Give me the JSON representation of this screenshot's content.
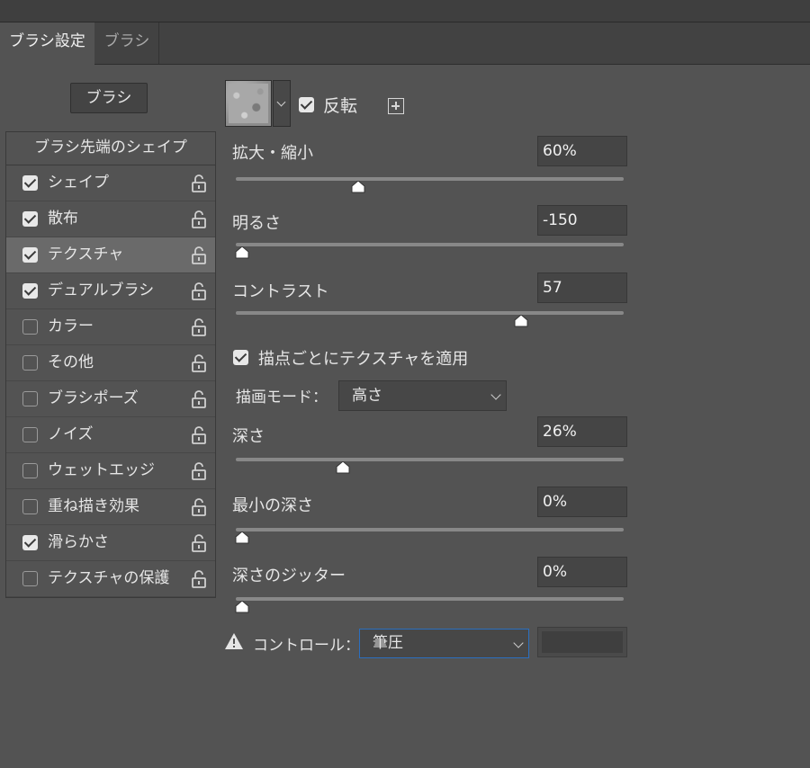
{
  "tabs": [
    {
      "label": "ブラシ設定",
      "active": true
    },
    {
      "label": "ブラシ",
      "active": false
    }
  ],
  "brush_button": "ブラシ",
  "left_panel": {
    "header": "ブラシ先端のシェイプ",
    "items": [
      {
        "label": "シェイプ",
        "checked": true,
        "selected": false
      },
      {
        "label": "散布",
        "checked": true,
        "selected": false
      },
      {
        "label": "テクスチャ",
        "checked": true,
        "selected": true
      },
      {
        "label": "デュアルブラシ",
        "checked": true,
        "selected": false
      },
      {
        "label": "カラー",
        "checked": false,
        "selected": false
      },
      {
        "label": "その他",
        "checked": false,
        "selected": false
      },
      {
        "label": "ブラシポーズ",
        "checked": false,
        "selected": false
      },
      {
        "label": "ノイズ",
        "checked": false,
        "selected": false
      },
      {
        "label": "ウェットエッジ",
        "checked": false,
        "selected": false
      },
      {
        "label": "重ね描き効果",
        "checked": false,
        "selected": false
      },
      {
        "label": "滑らかさ",
        "checked": true,
        "selected": false
      },
      {
        "label": "テクスチャの保護",
        "checked": false,
        "selected": false
      }
    ]
  },
  "texture": {
    "invert_label": "反転",
    "invert_checked": true
  },
  "params": {
    "scale": {
      "label": "拡大・縮小",
      "value": "60%",
      "slider_level": 0.3
    },
    "brightness": {
      "label": "明るさ",
      "value": "-150",
      "slider_level": 0.0
    },
    "contrast": {
      "label": "コントラスト",
      "value": "57",
      "slider_level": 0.72
    },
    "depth": {
      "label": "深さ",
      "value": "26%",
      "slider_level": 0.26
    },
    "min_depth": {
      "label": "最小の深さ",
      "value": "0%",
      "slider_level": 0.0
    },
    "depth_jitter": {
      "label": "深さのジッター",
      "value": "0%",
      "slider_level": 0.0
    }
  },
  "apply_each_tip": {
    "label": "描点ごとにテクスチャを適用",
    "checked": true
  },
  "mode": {
    "label": "描画モード：",
    "value": "高さ"
  },
  "control": {
    "label": "コントロール：",
    "value": "筆圧"
  },
  "icons": {
    "lock": "unlock-icon",
    "plus": "new-preset-icon",
    "warning": "warning-icon",
    "dropdown": "chevron-down-icon"
  },
  "colors": {
    "panel_bg": "#535353",
    "selected_row": "#6a6a6a",
    "focus_border": "#2b6fbf"
  }
}
